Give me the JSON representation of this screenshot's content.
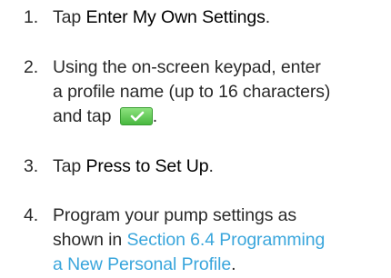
{
  "steps": [
    {
      "number": "1.",
      "parts": {
        "prefix": "Tap ",
        "emphasis": "Enter My Own Settings",
        "suffix": "."
      }
    },
    {
      "number": "2.",
      "lines": [
        "Using the on-screen keypad, enter",
        "a profile name (up to 16 characters)",
        "and tap "
      ],
      "suffix": ".",
      "button_icon": "checkmark-icon",
      "button_color": "#5cc94e"
    },
    {
      "number": "3.",
      "parts": {
        "prefix": "Tap ",
        "emphasis": "Press to Set Up",
        "suffix": "."
      }
    },
    {
      "number": "4.",
      "lines": [
        "Program your pump settings as",
        "shown in "
      ],
      "link_line1": "Section 6.4 Programming",
      "link_line2": "a New Personal Profile",
      "suffix": ".",
      "link_color": "#3aa6dc"
    }
  ]
}
